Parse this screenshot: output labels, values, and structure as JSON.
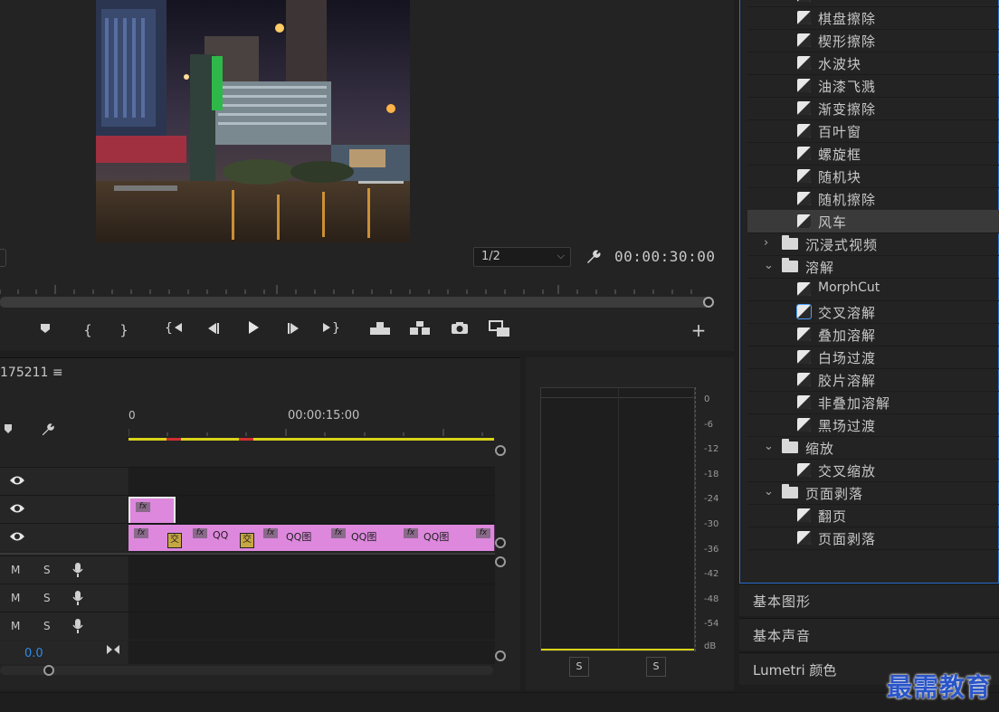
{
  "program_monitor": {
    "resolution": "1/2",
    "timecode": "00:00:30:00",
    "transport": {
      "icons": [
        "marker-icon",
        "in-point-icon",
        "out-point-icon",
        "go-to-in-icon",
        "step-back-icon",
        "play-icon",
        "step-forward-icon",
        "go-to-out-icon",
        "lift-icon",
        "extract-icon",
        "export-frame-icon",
        "compare-icon",
        "add-button-icon"
      ]
    }
  },
  "timeline": {
    "sequence_name": "175211",
    "menu_icon": "≡",
    "ruler_start": "0",
    "ruler_mid": "00:00:15:00",
    "video_tracks": [
      {
        "clips": []
      },
      {
        "clips": [
          {
            "fx": "fx",
            "label": ""
          }
        ]
      },
      {
        "clips": [
          {
            "fx": "fx",
            "label": ""
          },
          {
            "fx": "fx",
            "label": "QQ"
          },
          {
            "fx": "fx",
            "label": "QQ图"
          },
          {
            "fx": "fx",
            "label": "QQ图"
          },
          {
            "fx": "fx",
            "label": "QQ图"
          },
          {
            "fx": "fx",
            "label": ""
          }
        ]
      }
    ],
    "transitions": [
      "交",
      "交"
    ],
    "audio_tracks": [
      {
        "m": "M",
        "s": "S"
      },
      {
        "m": "M",
        "s": "S"
      },
      {
        "m": "M",
        "s": "S"
      }
    ],
    "master_volume": "0.0"
  },
  "audio_meter": {
    "scale": [
      "0",
      "-6",
      "-12",
      "-18",
      "-24",
      "-30",
      "-36",
      "-42",
      "-48",
      "-54",
      "dB"
    ],
    "solo_buttons": [
      "S",
      "S"
    ]
  },
  "effects": {
    "items": [
      {
        "type": "effect",
        "label": "棋盘擦除"
      },
      {
        "type": "effect",
        "label": "楔形擦除"
      },
      {
        "type": "effect",
        "label": "水波块"
      },
      {
        "type": "effect",
        "label": "油漆飞溅"
      },
      {
        "type": "effect",
        "label": "渐变擦除"
      },
      {
        "type": "effect",
        "label": "百叶窗"
      },
      {
        "type": "effect",
        "label": "螺旋框"
      },
      {
        "type": "effect",
        "label": "随机块"
      },
      {
        "type": "effect",
        "label": "随机擦除"
      },
      {
        "type": "effect",
        "label": "风车",
        "selected": true
      },
      {
        "type": "folder",
        "label": "沉浸式视频",
        "expanded": false
      },
      {
        "type": "folder",
        "label": "溶解",
        "expanded": true
      },
      {
        "type": "effect",
        "label": "MorphCut"
      },
      {
        "type": "effect",
        "label": "交叉溶解",
        "highlight": true
      },
      {
        "type": "effect",
        "label": "叠加溶解"
      },
      {
        "type": "effect",
        "label": "白场过渡"
      },
      {
        "type": "effect",
        "label": "胶片溶解"
      },
      {
        "type": "effect",
        "label": "非叠加溶解"
      },
      {
        "type": "effect",
        "label": "黑场过渡"
      },
      {
        "type": "folder",
        "label": "缩放",
        "expanded": true
      },
      {
        "type": "effect",
        "label": "交叉缩放"
      },
      {
        "type": "folder",
        "label": "页面剥落",
        "expanded": true
      },
      {
        "type": "effect",
        "label": "翻页"
      },
      {
        "type": "effect",
        "label": "页面剥落"
      }
    ]
  },
  "panels": [
    "基本图形",
    "基本声音",
    "Lumetri 颜色"
  ],
  "watermark": "最需教育"
}
